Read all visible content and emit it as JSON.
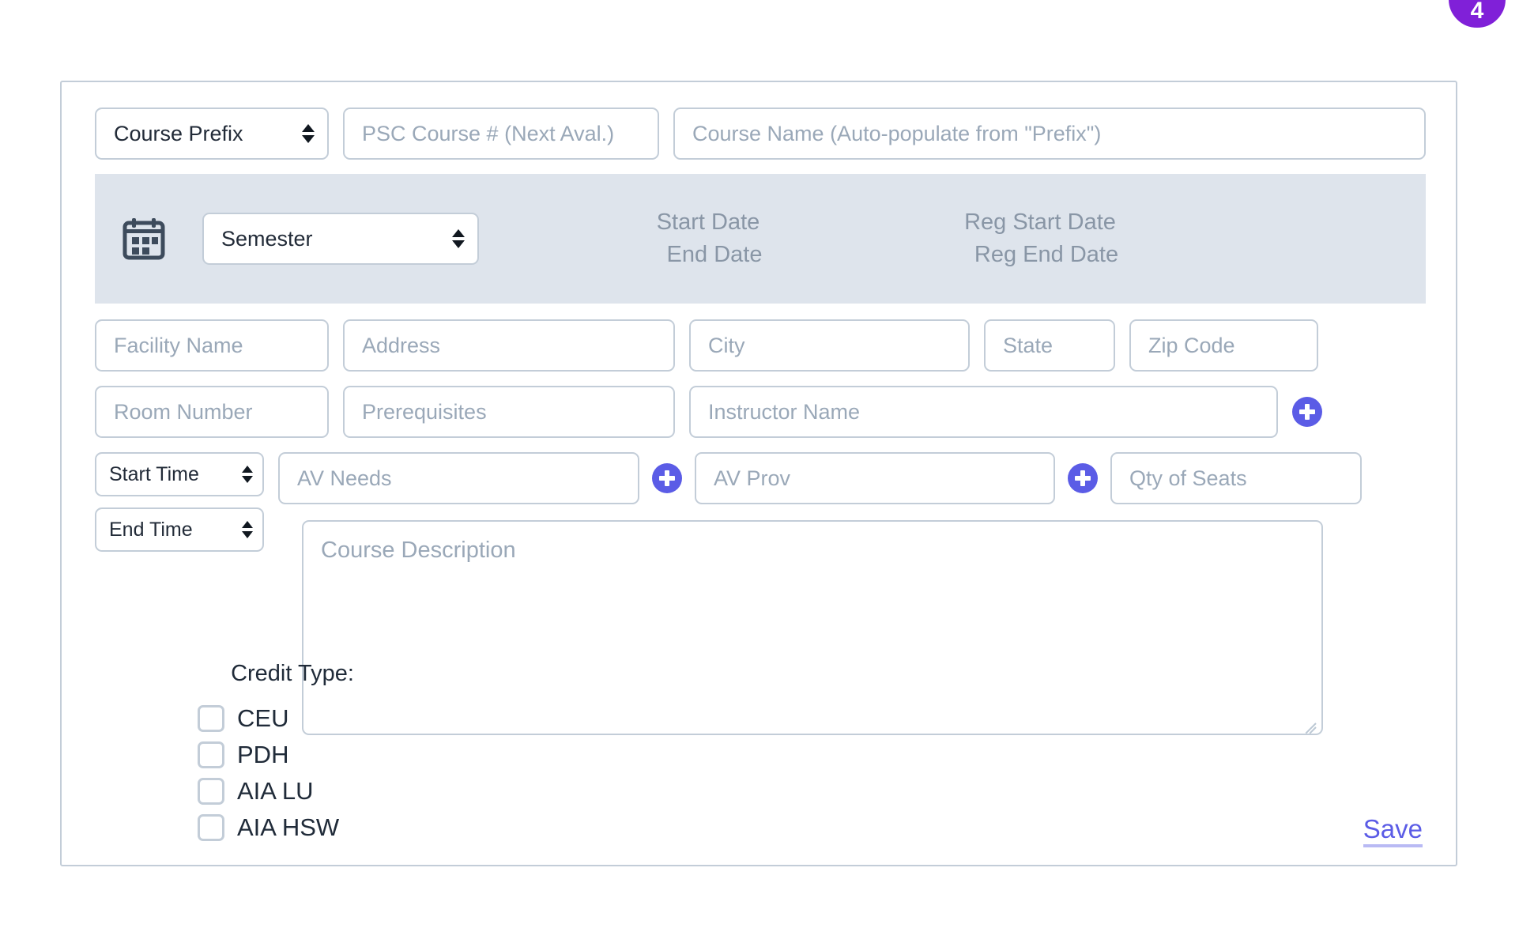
{
  "badge": {
    "text": "4",
    "color": "#8020d8"
  },
  "colors": {
    "accent": "#5b5ce6",
    "band": "#dee4ec",
    "border": "#c3cdd8",
    "placeholder": "#9aa8b8"
  },
  "form": {
    "course_prefix_select": {
      "value": "Course Prefix"
    },
    "course_number": {
      "placeholder": "PSC Course # (Next Aval.)",
      "value": ""
    },
    "course_name": {
      "placeholder": "Course Name (Auto-populate from \"Prefix\")",
      "value": ""
    },
    "semester_select": {
      "value": "Semester"
    },
    "calendar_icon": "calendar-icon",
    "dates": {
      "start_date": "Start Date",
      "end_date": "End Date",
      "reg_start_date": "Reg Start Date",
      "reg_end_date": "Reg End Date"
    },
    "facility_name": {
      "placeholder": "Facility Name",
      "value": ""
    },
    "address": {
      "placeholder": "Address",
      "value": ""
    },
    "city": {
      "placeholder": "City",
      "value": ""
    },
    "state": {
      "placeholder": "State",
      "value": ""
    },
    "zip_code": {
      "placeholder": "Zip Code",
      "value": ""
    },
    "room_number": {
      "placeholder": "Room Number",
      "value": ""
    },
    "prerequisites": {
      "placeholder": "Prerequisites",
      "value": ""
    },
    "instructor_name": {
      "placeholder": "Instructor Name",
      "value": ""
    },
    "start_time_select": {
      "value": "Start Time"
    },
    "end_time_select": {
      "value": "End Time"
    },
    "av_needs": {
      "placeholder": "AV Needs",
      "value": ""
    },
    "av_prov": {
      "placeholder": "AV Prov",
      "value": ""
    },
    "qty_of_seats": {
      "placeholder": "Qty of Seats",
      "value": ""
    },
    "course_description": {
      "placeholder": "Course Description",
      "value": ""
    },
    "credit_type": {
      "title": "Credit Type:",
      "options": [
        {
          "label": "CEU",
          "checked": false
        },
        {
          "label": "PDH",
          "checked": false
        },
        {
          "label": "AIA LU",
          "checked": false
        },
        {
          "label": "AIA HSW",
          "checked": false
        }
      ]
    },
    "save_label": "Save"
  }
}
